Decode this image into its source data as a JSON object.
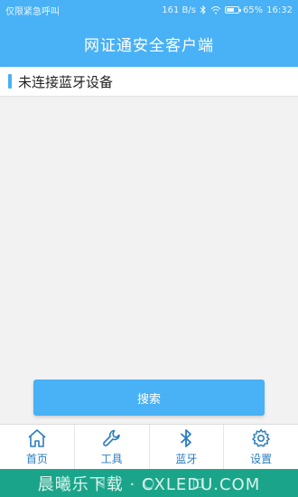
{
  "status_bar": {
    "carrier": "仅限紧急呼叫",
    "speed": "161 B/s",
    "battery": "65%",
    "battery_level": 0.65,
    "time": "16:32"
  },
  "header": {
    "title": "网证通安全客户端"
  },
  "bluetooth_status": {
    "label": "未连接蓝牙设备"
  },
  "search_button": {
    "label": "搜索"
  },
  "bottom_nav": {
    "items": [
      {
        "label": "首页",
        "icon": "home-icon"
      },
      {
        "label": "工具",
        "icon": "wrench-icon"
      },
      {
        "label": "蓝牙",
        "icon": "bluetooth-icon"
      },
      {
        "label": "设置",
        "icon": "gear-icon"
      }
    ]
  },
  "watermark": {
    "text": "晨曦乐下载 · CXLEDU.COM"
  },
  "colors": {
    "primary": "#49b1f5",
    "nav_text": "#2a7dc0",
    "system_bar": "#1aa58a"
  }
}
